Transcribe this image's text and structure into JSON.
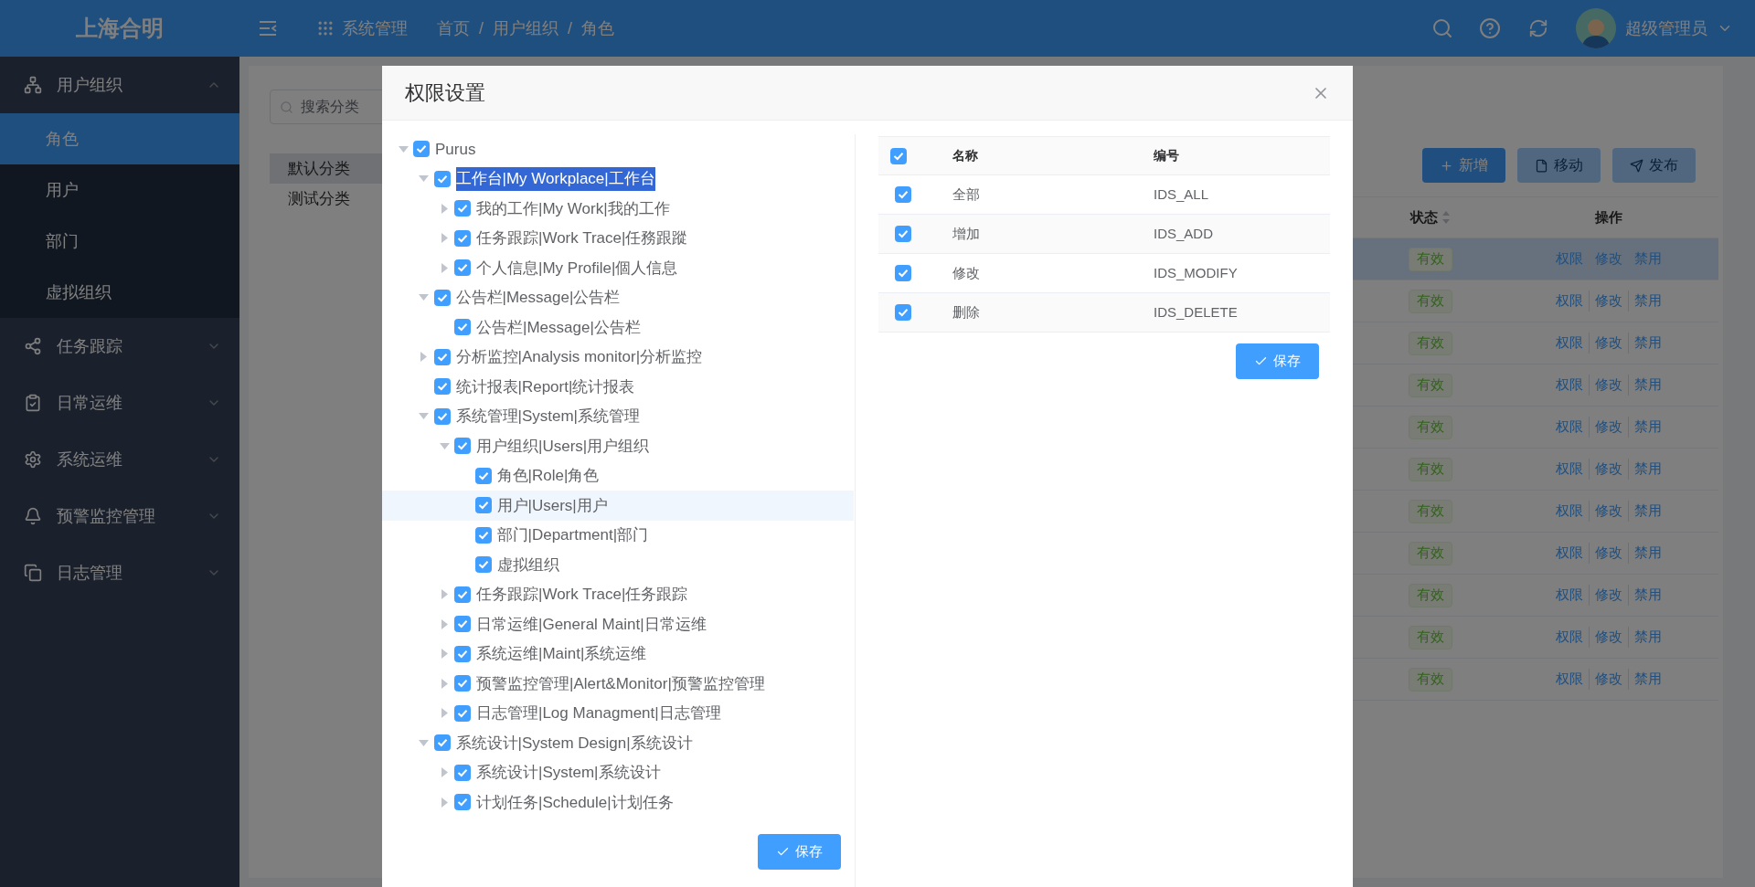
{
  "header": {
    "logo": "上海合明",
    "module": "系统管理",
    "breadcrumb": {
      "items": [
        "首页",
        "用户组织",
        "角色"
      ],
      "separator": "/"
    },
    "user": "超级管理员"
  },
  "sidebar": {
    "groups": [
      {
        "label": "用户组织",
        "expanded": true,
        "children": [
          {
            "label": "角色",
            "selected": true
          },
          {
            "label": "用户",
            "selected": false
          },
          {
            "label": "部门",
            "selected": false
          },
          {
            "label": "虚拟组织",
            "selected": false
          }
        ]
      },
      {
        "label": "任务跟踪",
        "expanded": false
      },
      {
        "label": "日常运维",
        "expanded": false
      },
      {
        "label": "系统运维",
        "expanded": false
      },
      {
        "label": "预警监控管理",
        "expanded": false
      },
      {
        "label": "日志管理",
        "expanded": false
      }
    ]
  },
  "categories": {
    "search_placeholder": "搜索分类",
    "items": [
      {
        "label": "默认分类",
        "selected": true
      },
      {
        "label": "测试分类",
        "selected": false
      }
    ]
  },
  "toolbar": [
    {
      "label": "新增",
      "disabled": false
    },
    {
      "label": "移动",
      "disabled": true
    },
    {
      "label": "发布",
      "disabled": true
    }
  ],
  "roles_table": {
    "columns": [
      "状态",
      "操作"
    ],
    "rows": [
      {
        "status": "有效",
        "actions": [
          "权限",
          "修改",
          "禁用"
        ],
        "selected": true
      },
      {
        "status": "有效",
        "actions": [
          "权限",
          "修改",
          "禁用"
        ],
        "selected": false
      },
      {
        "status": "有效",
        "actions": [
          "权限",
          "修改",
          "禁用"
        ],
        "selected": false
      },
      {
        "status": "有效",
        "actions": [
          "权限",
          "修改",
          "禁用"
        ],
        "selected": false
      },
      {
        "status": "有效",
        "actions": [
          "权限",
          "修改",
          "禁用"
        ],
        "selected": false
      },
      {
        "status": "有效",
        "actions": [
          "权限",
          "修改",
          "禁用"
        ],
        "selected": false
      },
      {
        "status": "有效",
        "actions": [
          "权限",
          "修改",
          "禁用"
        ],
        "selected": false
      },
      {
        "status": "有效",
        "actions": [
          "权限",
          "修改",
          "禁用"
        ],
        "selected": false
      },
      {
        "status": "有效",
        "actions": [
          "权限",
          "修改",
          "禁用"
        ],
        "selected": false
      },
      {
        "status": "有效",
        "actions": [
          "权限",
          "修改",
          "禁用"
        ],
        "selected": false
      },
      {
        "status": "有效",
        "actions": [
          "权限",
          "修改",
          "禁用"
        ],
        "selected": false
      }
    ]
  },
  "dialog": {
    "title": "权限设置",
    "tree": [
      {
        "label": "Purus",
        "kind": "branch",
        "expanded": true,
        "checked": true,
        "selected": false,
        "hovered": false,
        "children": [
          {
            "label": "工作台|My Workplace|工作台",
            "kind": "branch",
            "expanded": true,
            "checked": true,
            "selected": true,
            "hovered": false,
            "children": [
              {
                "label": "我的工作|My Work|我的工作",
                "kind": "branch",
                "expanded": false,
                "checked": true,
                "selected": false,
                "hovered": false
              },
              {
                "label": "任务跟踪|Work Trace|任務跟蹤",
                "kind": "branch",
                "expanded": false,
                "checked": true,
                "selected": false,
                "hovered": false
              },
              {
                "label": "个人信息|My Profile|個人信息",
                "kind": "branch",
                "expanded": false,
                "checked": true,
                "selected": false,
                "hovered": false
              }
            ]
          },
          {
            "label": "公告栏|Message|公告栏",
            "kind": "branch",
            "expanded": true,
            "checked": true,
            "selected": false,
            "hovered": false,
            "children": [
              {
                "label": "公告栏|Message|公告栏",
                "kind": "leaf",
                "checked": true,
                "selected": false,
                "hovered": false
              }
            ]
          },
          {
            "label": "分析监控|Analysis monitor|分析监控",
            "kind": "branch",
            "expanded": false,
            "checked": true,
            "selected": false,
            "hovered": false
          },
          {
            "label": "统计报表|Report|统计报表",
            "kind": "leaf",
            "checked": true,
            "selected": false,
            "hovered": false
          },
          {
            "label": "系统管理|System|系统管理",
            "kind": "branch",
            "expanded": true,
            "checked": true,
            "selected": false,
            "hovered": false,
            "children": [
              {
                "label": "用户组织|Users|用户组织",
                "kind": "branch",
                "expanded": true,
                "checked": true,
                "selected": false,
                "hovered": false,
                "children": [
                  {
                    "label": "角色|Role|角色",
                    "kind": "leaf",
                    "checked": true,
                    "selected": false,
                    "hovered": false
                  },
                  {
                    "label": "用户|Users|用户",
                    "kind": "leaf",
                    "checked": true,
                    "selected": false,
                    "hovered": true
                  },
                  {
                    "label": "部门|Department|部门",
                    "kind": "leaf",
                    "checked": true,
                    "selected": false,
                    "hovered": false
                  },
                  {
                    "label": "虚拟组织",
                    "kind": "leaf",
                    "checked": true,
                    "selected": false,
                    "hovered": false
                  }
                ]
              },
              {
                "label": "任务跟踪|Work Trace|任务跟踪",
                "kind": "branch",
                "expanded": false,
                "checked": true,
                "selected": false,
                "hovered": false
              },
              {
                "label": "日常运维|General Maint|日常运维",
                "kind": "branch",
                "expanded": false,
                "checked": true,
                "selected": false,
                "hovered": false
              },
              {
                "label": "系统运维|Maint|系统运维",
                "kind": "branch",
                "expanded": false,
                "checked": true,
                "selected": false,
                "hovered": false
              },
              {
                "label": "预警监控管理|Alert&Monitor|预警监控管理",
                "kind": "branch",
                "expanded": false,
                "checked": true,
                "selected": false,
                "hovered": false
              },
              {
                "label": "日志管理|Log Managment|日志管理",
                "kind": "branch",
                "expanded": false,
                "checked": true,
                "selected": false,
                "hovered": false
              }
            ]
          },
          {
            "label": "系统设计|System Design|系统设计",
            "kind": "branch",
            "expanded": true,
            "checked": true,
            "selected": false,
            "hovered": false,
            "children": [
              {
                "label": "系统设计|System|系统设计",
                "kind": "branch",
                "expanded": false,
                "checked": true,
                "selected": false,
                "hovered": false
              },
              {
                "label": "计划任务|Schedule|计划任务",
                "kind": "branch",
                "expanded": false,
                "checked": true,
                "selected": false,
                "hovered": false
              }
            ]
          }
        ]
      }
    ],
    "tree_save": "保存",
    "permissions": {
      "all_checked": true,
      "columns": [
        "名称",
        "编号"
      ],
      "rows": [
        {
          "name": "全部",
          "code": "IDS_ALL",
          "checked": true
        },
        {
          "name": "增加",
          "code": "IDS_ADD",
          "checked": true
        },
        {
          "name": "修改",
          "code": "IDS_MODIFY",
          "checked": true
        },
        {
          "name": "删除",
          "code": "IDS_DELETE",
          "checked": true
        }
      ]
    },
    "permissions_save": "保存"
  }
}
